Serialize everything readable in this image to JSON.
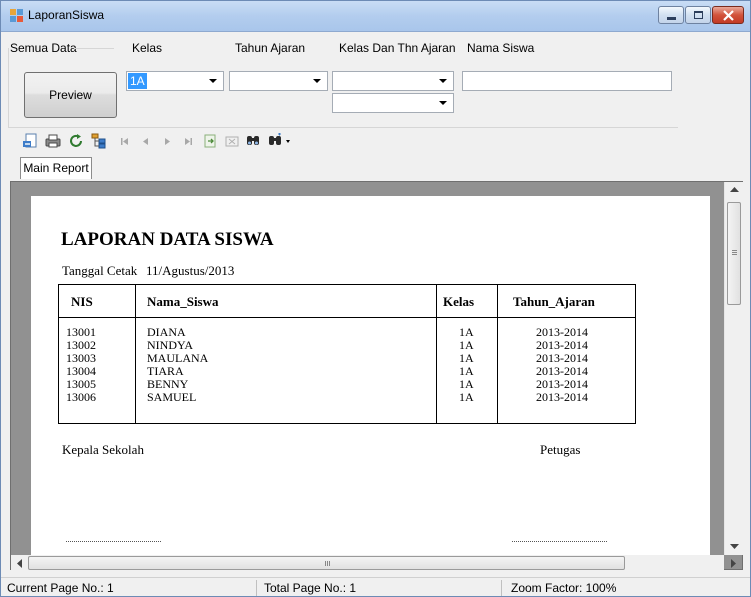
{
  "window": {
    "title": "LaporanSiswa"
  },
  "filters": {
    "semua_data_label": "Semua Data",
    "preview_label": "Preview",
    "kelas_label": "Kelas",
    "kelas_value": "1A",
    "tahun_ajaran_label": "Tahun Ajaran",
    "tahun_ajaran_value": "",
    "kelas_thn_label": "Kelas Dan Thn Ajaran",
    "nama_siswa_label": "Nama Siswa",
    "nama_siswa_value": ""
  },
  "tabs": {
    "main_report": "Main Report"
  },
  "report": {
    "title": "LAPORAN DATA SISWA",
    "tanggal_label": "Tanggal Cetak",
    "tanggal_value": "11/Agustus/2013",
    "columns": [
      "NIS",
      "Nama_Siswa",
      "Kelas",
      "Tahun_Ajaran"
    ],
    "rows": [
      [
        "13001",
        "DIANA",
        "1A",
        "2013-2014"
      ],
      [
        "13002",
        "NINDYA",
        "1A",
        "2013-2014"
      ],
      [
        "13003",
        "MAULANA",
        "1A",
        "2013-2014"
      ],
      [
        "13004",
        "TIARA",
        "1A",
        "2013-2014"
      ],
      [
        "13005",
        "BENNY",
        "1A",
        "2013-2014"
      ],
      [
        "13006",
        "SAMUEL",
        "1A",
        "2013-2014"
      ]
    ],
    "kepala_label": "Kepala Sekolah",
    "petugas_label": "Petugas"
  },
  "status": {
    "current_page": "Current Page No.: 1",
    "total_page": "Total Page No.: 1",
    "zoom": "Zoom Factor: 100%"
  },
  "colors": {
    "accent": "#3399ff",
    "title_bar": "#b3cdee",
    "viewer_bg": "#919191"
  },
  "icons": [
    "export-icon",
    "print-icon",
    "refresh-icon",
    "group-tree-icon",
    "first-page-icon",
    "prev-page-icon",
    "next-page-icon",
    "last-page-icon",
    "goto-page-icon",
    "close-view-icon",
    "find-icon",
    "zoom-icon"
  ]
}
